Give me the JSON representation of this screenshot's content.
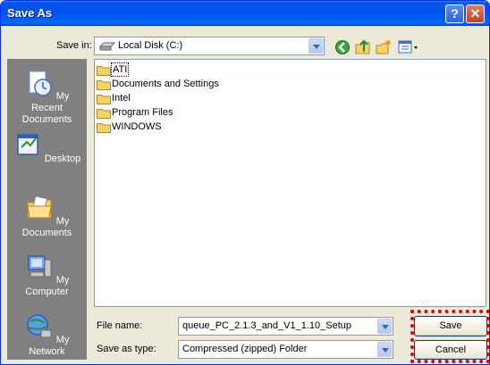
{
  "window": {
    "title": "Save As"
  },
  "titlebar": {
    "help_glyph": "?",
    "close_glyph": "✕"
  },
  "toolbar": {
    "save_in_label": "Save in:",
    "location": "Local Disk (C:)",
    "location_icon": "drive-icon",
    "buttons": [
      "back-icon",
      "up-folder-icon",
      "new-folder-icon",
      "views-menu-icon"
    ]
  },
  "places": [
    {
      "label": "My Recent Documents",
      "icon": "recent-documents-icon"
    },
    {
      "label": "Desktop",
      "icon": "desktop-icon"
    },
    {
      "label": "My Documents",
      "icon": "my-documents-icon"
    },
    {
      "label": "My Computer",
      "icon": "my-computer-icon"
    },
    {
      "label": "My Network",
      "icon": "my-network-icon"
    }
  ],
  "files": [
    {
      "name": "ATI",
      "selected": true
    },
    {
      "name": "Documents and Settings",
      "selected": false
    },
    {
      "name": "Intel",
      "selected": false
    },
    {
      "name": "Program Files",
      "selected": false
    },
    {
      "name": "WINDOWS",
      "selected": false
    }
  ],
  "form": {
    "file_name_label": "File name:",
    "file_name_value": "queue_PC_2.1.3_and_V1_1.10_Setup",
    "save_as_type_label": "Save as type:",
    "save_as_type_value": "Compressed (zipped) Folder"
  },
  "buttons": {
    "save": "Save",
    "cancel": "Cancel"
  },
  "colors": {
    "title_bar": "#0053ee",
    "places_bar": "#808080",
    "highlight": "#e00000"
  }
}
